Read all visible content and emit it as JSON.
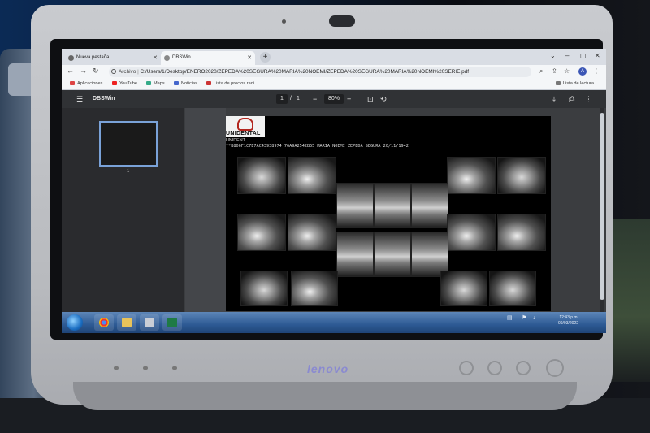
{
  "browser": {
    "tabs": [
      {
        "label": "Nueva pestaña",
        "active": false
      },
      {
        "label": "DBSWin",
        "active": true
      }
    ],
    "new_tab": "+",
    "address": {
      "scheme_label": "Archivo",
      "url": "C:/Users/1/Desktop/ENERO2020/ZEPEDA%20SEGURA%20MARIA%20NOEMI/ZEPEDA%20SEGURA%20MARIA%20NOEMI%20SERIE.pdf"
    },
    "profile_initial": "A",
    "bookmarks": [
      {
        "label": "Aplicaciones",
        "color": "#d44"
      },
      {
        "label": "YouTube",
        "color": "#e22"
      },
      {
        "label": "Maps",
        "color": "#3a8"
      },
      {
        "label": "Noticias",
        "color": "#46c"
      },
      {
        "label": "Lista de precios radi...",
        "color": "#c33"
      }
    ],
    "reading_list": "Lista de lectura"
  },
  "pdf_viewer": {
    "title": "DBSWin",
    "page_current": "1",
    "page_separator": "/",
    "page_total": "1",
    "zoom_minus": "−",
    "zoom": "80%",
    "zoom_plus": "+",
    "thumbnail_number": "1",
    "page": {
      "logo_text": "UNIDENTAL",
      "clinic": "UNIDENT",
      "patient_line": "**B806F1C7E7AC43938974 76A9A2542B55 MARIA NOEMI  ZEPEDA SEGURA  20/11/1942"
    }
  },
  "taskbar": {
    "time": "12:43 p.m.",
    "date": "09/03/2022"
  },
  "monitor": {
    "brand": "lenovo"
  }
}
